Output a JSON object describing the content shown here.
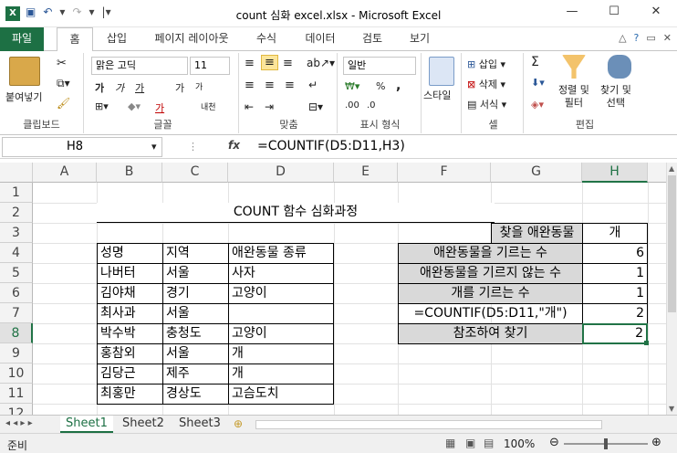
{
  "window": {
    "title": "count 심화 excel.xlsx  -  Microsoft Excel",
    "minimize": "—",
    "maximize": "☐",
    "close": "✕"
  },
  "tabs": [
    "파일",
    "홈",
    "삽입",
    "페이지 레이아웃",
    "수식",
    "데이터",
    "검토",
    "보기"
  ],
  "ribbon": {
    "clipboard": {
      "paste": "붙여넣기",
      "group": "클립보드"
    },
    "font": {
      "name": "맑은 고딕",
      "size": "11",
      "bold": "가",
      "italic": "가",
      "underline": "가",
      "grow": "가",
      "shrink": "가",
      "color": "가",
      "phonetic": "내천",
      "group": "글꼴"
    },
    "align": {
      "group": "맞춤"
    },
    "number": {
      "format": "일반",
      "percent": "%",
      "comma": ",",
      "group": "표시 형식"
    },
    "styles": {
      "label": "스타일",
      "group": ""
    },
    "cells": {
      "insert": "삽입",
      "delete": "삭제",
      "format": "서식",
      "group": "셀"
    },
    "editing": {
      "sum": "Σ",
      "sort": "정렬 및\n필터",
      "find": "찾기 및\n선택",
      "group": "편집"
    }
  },
  "formula_bar": {
    "name_box": "H8",
    "fx": "fx",
    "formula": "=COUNTIF(D5:D11,H3)"
  },
  "columns": [
    "A",
    "B",
    "C",
    "D",
    "E",
    "F",
    "G",
    "H"
  ],
  "rows": [
    "1",
    "2",
    "3",
    "4",
    "5",
    "6",
    "7",
    "8",
    "9",
    "10",
    "11",
    "12"
  ],
  "sheet": {
    "title": "COUNT 함수 심화과정",
    "headers": [
      "성명",
      "지역",
      "애완동물 종류"
    ],
    "table": [
      [
        "나버터",
        "서울",
        "사자"
      ],
      [
        "김야채",
        "경기",
        "고양이"
      ],
      [
        "최사과",
        "서울",
        ""
      ],
      [
        "박수박",
        "충청도",
        "고양이"
      ],
      [
        "홍참외",
        "서울",
        "개"
      ],
      [
        "김당근",
        "제주",
        "개"
      ],
      [
        "최홍만",
        "경상도",
        "고슴도치"
      ]
    ],
    "search_label": "찾을 애완동물",
    "search_value": "개",
    "summary": [
      {
        "label": "애완동물을 기르는 수",
        "value": "6"
      },
      {
        "label": "애완동물을 기르지 않는 수",
        "value": "1"
      },
      {
        "label": "개를 기르는 수",
        "value": "1"
      },
      {
        "label": "=COUNTIF(D5:D11,\"개\")",
        "value": "2"
      },
      {
        "label": "참조하여 찾기",
        "value": "2"
      }
    ]
  },
  "sheets": [
    "Sheet1",
    "Sheet2",
    "Sheet3"
  ],
  "status": {
    "ready": "준비",
    "zoom": "100%",
    "zoom_fraction": 0.5
  }
}
